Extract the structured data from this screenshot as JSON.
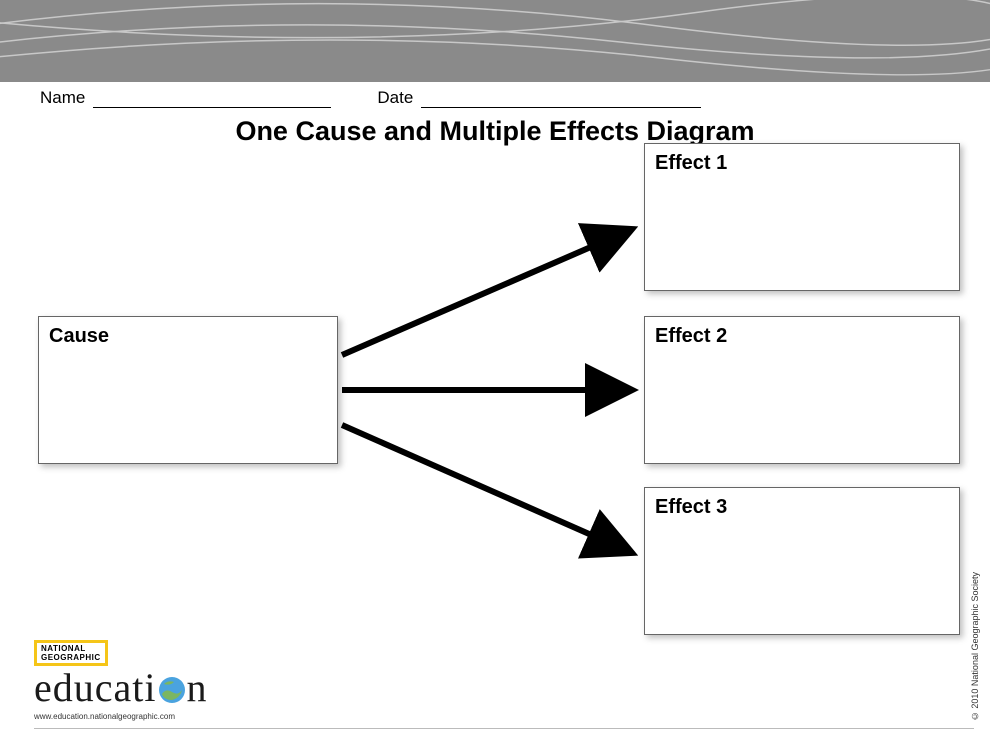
{
  "meta": {
    "name_label": "Name",
    "date_label": "Date"
  },
  "title": "One Cause and Multiple Effects Diagram",
  "boxes": {
    "cause": "Cause",
    "effect1": "Effect 1",
    "effect2": "Effect 2",
    "effect3": "Effect 3"
  },
  "brand": {
    "badge": "NATIONAL\nGEOGRAPHIC",
    "word_pre": "educati",
    "word_post": "n",
    "url": "www.education.nationalgeographic.com"
  },
  "copyright": "© 2010 National Geographic Society"
}
